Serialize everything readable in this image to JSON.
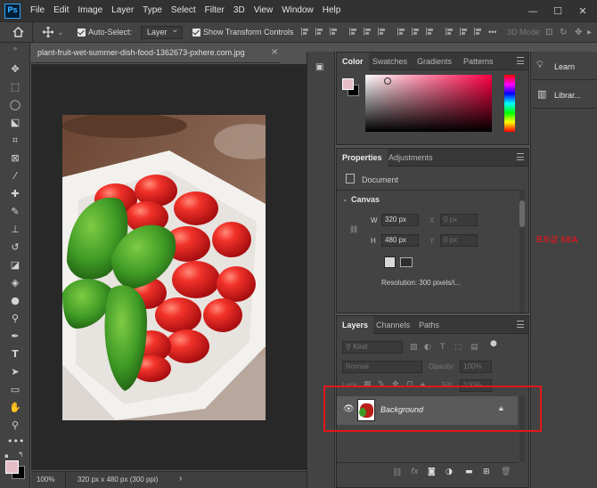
{
  "app": {
    "logo_text": "Ps"
  },
  "menubar": {
    "items": [
      "File",
      "Edit",
      "Image",
      "Layer",
      "Type",
      "Select",
      "Filter",
      "3D",
      "View",
      "Window",
      "Help"
    ]
  },
  "window_controls": {
    "minimize": "—",
    "maximize": "☐",
    "close": "✕"
  },
  "options_bar": {
    "auto_select_label": "Auto-Select:",
    "auto_select_target": "Layer",
    "show_transform_label": "Show Transform Controls",
    "mode_3d_label": "3D Mode:",
    "more_label": "•••"
  },
  "document": {
    "tab_title": "plant-fruit-wet-summer-dish-food-1362673-pxhere.com.jpg",
    "tab_close": "×",
    "zoom": "100%",
    "status": "320 px x 480 px (300 ppi)",
    "status_arrow": "›"
  },
  "color_panel": {
    "tabs": [
      "Color",
      "Swatches",
      "Gradients",
      "Patterns"
    ],
    "active_tab": "Color",
    "fg_color": "#e4bcc6",
    "bg_color": "#000000",
    "hue_color": "#ff0044"
  },
  "properties_panel": {
    "tabs": [
      "Properties",
      "Adjustments"
    ],
    "document_label": "Document",
    "canvas_label": "Canvas",
    "w_label": "W",
    "w_value": "320 px",
    "x_label": "X",
    "x_value": "0 px",
    "h_label": "H",
    "h_value": "480 px",
    "y_label": "Y",
    "y_value": "0 px",
    "resolution": "Resolution: 300 pixels/i..."
  },
  "layers_panel": {
    "tabs": [
      "Layers",
      "Channels",
      "Paths"
    ],
    "kind_label": "Kind",
    "blend_mode": "Normal",
    "opacity_label": "Opacity:",
    "opacity_value": "100%",
    "lock_label": "Lock:",
    "fill_label": "Fill:",
    "fill_value": "100%",
    "layers": [
      {
        "name": "Background",
        "visible": true,
        "locked": true
      }
    ],
    "footer_icons": [
      "link-icon",
      "fx-icon",
      "mask-icon",
      "adjustment-icon",
      "group-icon",
      "new-layer-icon",
      "trash-icon"
    ],
    "footer_fx": "fx"
  },
  "learn_panel": {
    "items": [
      {
        "label": "Learn",
        "icon": "lightbulb-icon"
      },
      {
        "label": "Librar...",
        "icon": "library-icon"
      }
    ]
  },
  "watermark": {
    "text": "포토샵 SEA"
  },
  "highlight_color": "#e2181d"
}
